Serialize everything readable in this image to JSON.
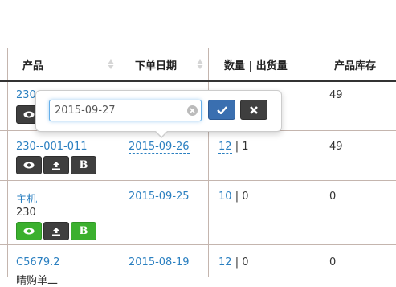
{
  "table": {
    "headers": [
      {
        "label": "产品",
        "sortable": true
      },
      {
        "label": "下单日期",
        "sortable": true
      },
      {
        "label": "数量 | 出货量",
        "sortable": false
      },
      {
        "label": "产品库存",
        "sortable": false
      }
    ],
    "rows": [
      {
        "product_link": "230",
        "product_sub": "",
        "date": "",
        "qty": "",
        "shipped": "",
        "stock": "49",
        "buttons": "dark"
      },
      {
        "product_link": "230--001-011",
        "product_sub": "",
        "date": "2015-09-26",
        "qty": "12",
        "sep": "|",
        "shipped": "1",
        "stock": "49",
        "buttons": "dark"
      },
      {
        "product_link": "主机",
        "product_sub": "230",
        "date": "2015-09-25",
        "qty": "10",
        "sep": "|",
        "shipped": "0",
        "stock": "0",
        "buttons": "green"
      },
      {
        "product_link": "C5679.2",
        "product_sub": "晴购单二",
        "date": "2015-08-19",
        "qty": "12",
        "sep": "|",
        "shipped": "0",
        "stock": "0",
        "buttons": "none"
      }
    ],
    "button_b_label": "B"
  },
  "popover": {
    "input_value": "2015-09-27",
    "confirm_icon": "check-icon",
    "cancel_icon": "x-icon"
  },
  "colors": {
    "link": "#2a7fc0",
    "confirm": "#3a6fb0",
    "dark_button": "#3f3f3f",
    "green_button": "#3bb02e",
    "grid_line": "#c4b5ae"
  }
}
